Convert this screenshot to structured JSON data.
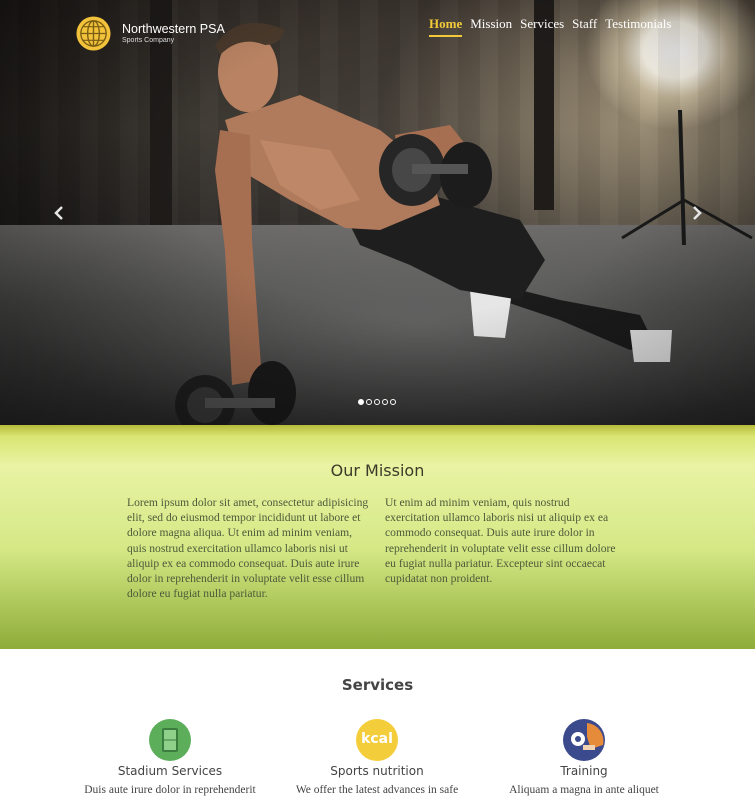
{
  "brand": {
    "name": "Northwestern PSA",
    "subtitle": "Sports Company"
  },
  "nav": {
    "items": [
      {
        "label": "Home",
        "active": true
      },
      {
        "label": "Mission",
        "active": false
      },
      {
        "label": "Services",
        "active": false
      },
      {
        "label": "Staff",
        "active": false
      },
      {
        "label": "Testimonials",
        "active": false
      }
    ]
  },
  "slider": {
    "prev_icon": "chevron-left-icon",
    "next_icon": "chevron-right-icon",
    "slide_count": 5,
    "active_slide": 1
  },
  "mission": {
    "title": "Our Mission",
    "col_left": "Lorem ipsum dolor sit amet, consectetur adipisicing elit, sed do eiusmod tempor incididunt ut labore et dolore magna aliqua. Ut enim ad minim veniam, quis nostrud exercitation ullamco laboris nisi ut aliquip ex ea commodo consequat. Duis aute irure dolor in reprehenderit in voluptate velit esse cillum dolore eu fugiat nulla pariatur.",
    "col_right": "Ut enim ad minim veniam, quis nostrud exercitation ullamco laboris nisi ut aliquip ex ea commodo consequat. Duis aute irure dolor in reprehenderit in voluptate velit esse cillum dolore eu fugiat nulla pariatur. Excepteur sint occaecat cupidatat non proident."
  },
  "services": {
    "title": "Services",
    "items": [
      {
        "name": "Stadium Services",
        "desc": "Duis aute irure dolor in reprehenderit",
        "icon": "stadium-icon",
        "color": "#5cae5a"
      },
      {
        "name": "Sports nutrition",
        "desc": "We offer the latest advances in safe",
        "icon": "kcal-icon",
        "icon_text": "kcal",
        "color": "#f4cd3a"
      },
      {
        "name": "Training",
        "desc": "Aliquam a magna in ante aliquet",
        "icon": "training-icon",
        "color": "#3b4a8c"
      }
    ]
  },
  "colors": {
    "accent": "#f3c93a",
    "mission_green": "#d5e886"
  }
}
